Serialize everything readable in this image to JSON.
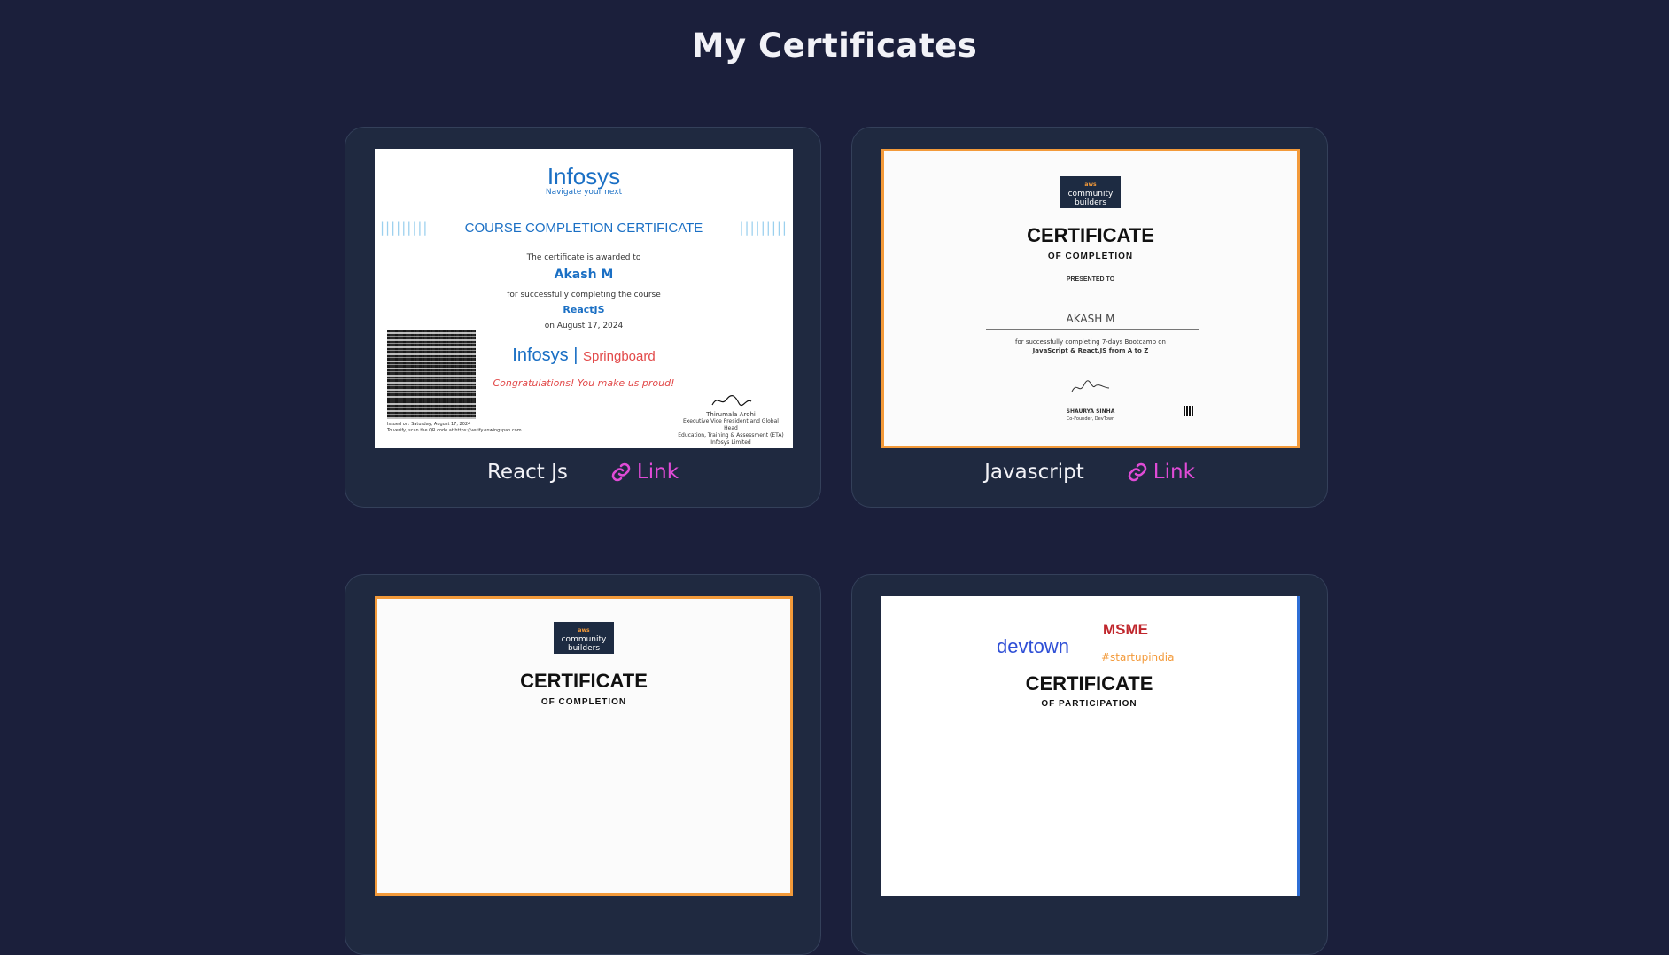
{
  "page": {
    "title": "My Certificates"
  },
  "certificates": [
    {
      "name": "React Js",
      "link_label": "Link",
      "image": {
        "logo": "Infosys",
        "tagline": "Navigate your next",
        "bars_left": "|||||||||",
        "bars_right": "|||||||||",
        "heading": "COURSE COMPLETION CERTIFICATE",
        "awarded_to": "The certificate is awarded to",
        "recipient": "Akash M",
        "for_text": "for successfully completing the course",
        "course": "ReactJS",
        "date": "on August 17, 2024",
        "brand_a": "Infosys",
        "brand_sep": " | ",
        "brand_b": "Springboard",
        "congrats": "Congratulations! You make us proud!",
        "signer_name": "Thirumala Arohi",
        "signer_title": "Executive Vice President and Global Head",
        "signer_title2": "Education, Training & Assessment (ETA)",
        "signer_org": "Infosys Limited",
        "issued_line": "Issued on: Saturday, August 17, 2024",
        "verify_line": "To verify, scan the QR code at https://verify.onwingspan.com"
      }
    },
    {
      "name": "Javascript",
      "link_label": "Link",
      "image": {
        "badge_top": "aws",
        "badge_mid": "community",
        "badge_bottom": "builders",
        "heading": "CERTIFICATE",
        "subheading": "OF COMPLETION",
        "presented": "PRESENTED TO",
        "recipient": "AKASH M",
        "for_text": "for successfully completing 7-days Bootcamp on",
        "course": "JavaScript & React.JS from A to Z",
        "signer_name": "SHAURYA SINHA",
        "signer_title": "Co-Founder, DevTown"
      }
    },
    {
      "image": {
        "badge_top": "aws",
        "badge_mid": "community",
        "badge_bottom": "builders",
        "heading": "CERTIFICATE",
        "subheading": "OF COMPLETION"
      }
    },
    {
      "image": {
        "logo_left": "devtown",
        "logo_right": "MSME",
        "hashtag": "#startupindia",
        "heading": "CERTIFICATE",
        "subheading": "OF PARTICIPATION"
      }
    }
  ],
  "icons": {
    "link": "link-icon"
  },
  "colors": {
    "background": "#1b1f3b",
    "card": "#1f2940",
    "link": "#e04bd6",
    "aws_orange": "#f39a3a"
  }
}
